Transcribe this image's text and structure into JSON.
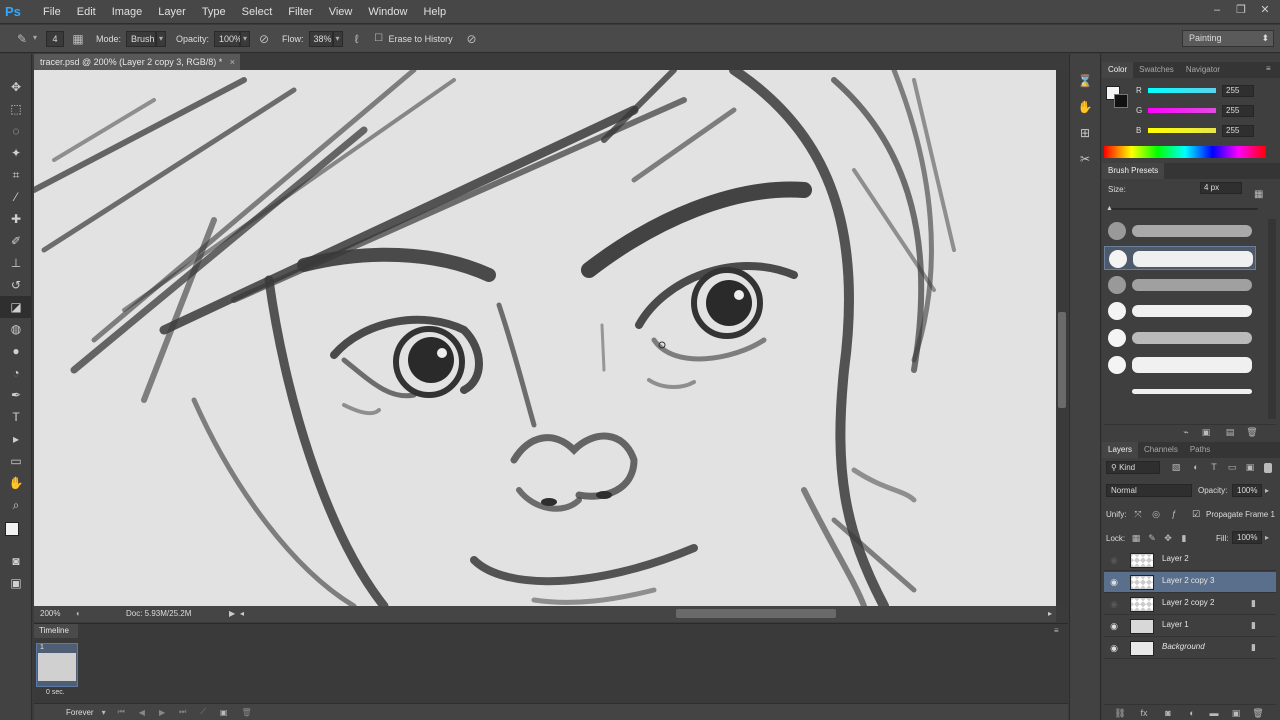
{
  "app": {
    "logo": "Ps"
  },
  "menu": [
    "File",
    "Edit",
    "Image",
    "Layer",
    "Type",
    "Select",
    "Filter",
    "View",
    "Window",
    "Help"
  ],
  "window_controls": {
    "minimize": "–",
    "restore": "❐",
    "close": "✕"
  },
  "options_bar": {
    "brush_size": "4",
    "mode_label": "Mode:",
    "mode_value": "Brush",
    "opacity_label": "Opacity:",
    "opacity_value": "100%",
    "flow_label": "Flow:",
    "flow_value": "38%",
    "erase_to_history": "Erase to History",
    "workspace": "Painting"
  },
  "document": {
    "tab_title": "tracer.psd @ 200% (Layer 2 copy 3, RGB/8) *",
    "zoom": "200%",
    "doc_size": "Doc: 5.93M/25.2M"
  },
  "timeline": {
    "tab": "Timeline",
    "frame_number": "1",
    "frame_delay": "0 sec.",
    "loop": "Forever"
  },
  "color_panel": {
    "tabs": [
      "Color",
      "Swatches",
      "Navigator"
    ],
    "r_label": "R",
    "r_value": "255",
    "g_label": "G",
    "g_value": "255",
    "b_label": "B",
    "b_value": "255",
    "r_color": "#5fd3ec",
    "g_color": "#e14ce0",
    "b_color": "#e6e64a"
  },
  "brush_presets": {
    "tab": "Brush Presets",
    "size_label": "Size:",
    "size_value": "4 px"
  },
  "layers_panel": {
    "tabs": [
      "Layers",
      "Channels",
      "Paths"
    ],
    "kind": "Kind",
    "blend_mode": "Normal",
    "opacity_label": "Opacity:",
    "opacity_value": "100%",
    "unify_label": "Unify:",
    "propagate_label": "Propagate Frame 1",
    "lock_label": "Lock:",
    "fill_label": "Fill:",
    "fill_value": "100%",
    "layers": [
      {
        "name": "Layer 2",
        "visible": false,
        "selected": false,
        "locked": false,
        "italic": false
      },
      {
        "name": "Layer 2 copy 3",
        "visible": true,
        "selected": true,
        "locked": false,
        "italic": false
      },
      {
        "name": "Layer 2 copy 2",
        "visible": false,
        "selected": false,
        "locked": true,
        "italic": false
      },
      {
        "name": "Layer 1",
        "visible": true,
        "selected": false,
        "locked": true,
        "italic": false
      },
      {
        "name": "Background",
        "visible": true,
        "selected": false,
        "locked": true,
        "italic": true
      }
    ]
  },
  "icons": {
    "eye": "◉",
    "lock": "🔒"
  }
}
